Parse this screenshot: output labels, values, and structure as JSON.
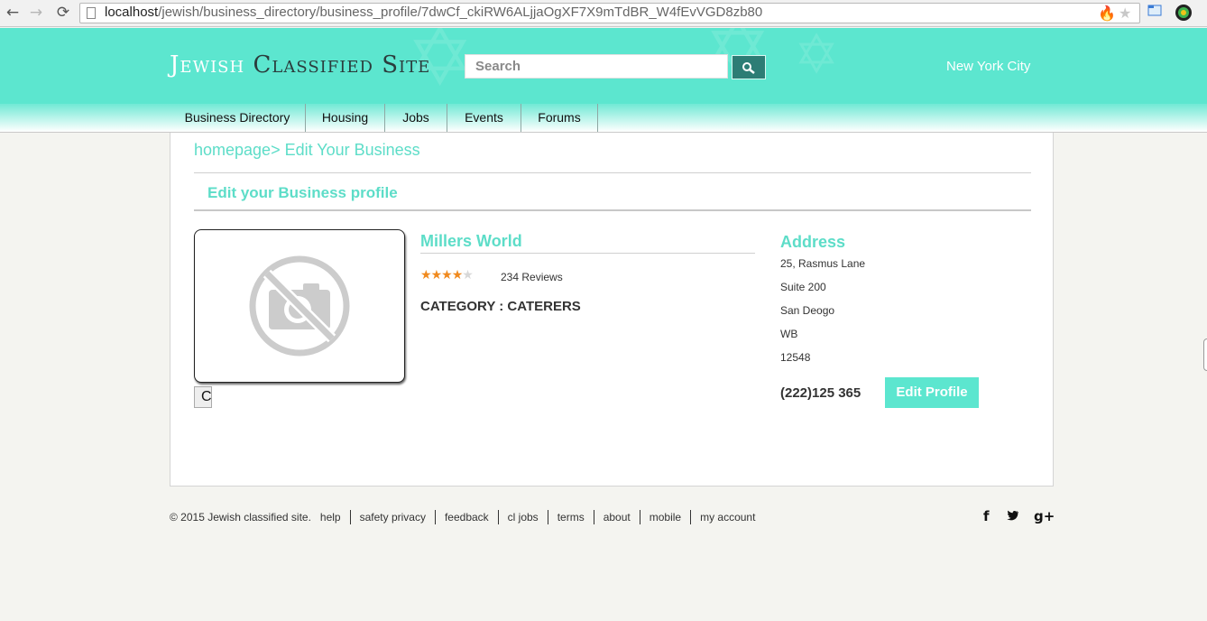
{
  "browser": {
    "back_icon": "←",
    "forward_icon": "→",
    "reload_icon": "⟳",
    "url_host": "localhost",
    "url_path": "/jewish/business_directory/business_profile/7dwCf_ckiRW6ALjjaOgXF7X9mTdBR_W4fEvVGD8zb80",
    "star_icon": "★",
    "flame_icon": "🔥"
  },
  "header": {
    "logo_word1": "Jewish",
    "logo_word2": "Classified Site",
    "search_placeholder": "Search",
    "city": "New York City",
    "brand_color": "#5ce6cf"
  },
  "nav": {
    "items": [
      {
        "label": "Business Directory"
      },
      {
        "label": "Housing"
      },
      {
        "label": "Jobs"
      },
      {
        "label": "Events"
      },
      {
        "label": "Forums"
      }
    ]
  },
  "main": {
    "breadcrumb": "homepage> Edit Your Business",
    "section_title": "Edit your Business profile",
    "change_button_label": "C",
    "business_name": "Millers World",
    "rating": 4,
    "rating_max": 5,
    "reviews": "234 Reviews",
    "category": "CATEGORY : CATERERS",
    "address_title": "Address",
    "address_lines": [
      "25, Rasmus Lane",
      "Suite 200",
      "San Deogo",
      "WB",
      "12548"
    ],
    "phone": "(222)125 365",
    "edit_button_label": "Edit Profile"
  },
  "footer": {
    "copyright": "© 2015 Jewish classified site.",
    "links": [
      "help",
      "safety privacy",
      "feedback",
      "cl jobs",
      "terms",
      "about",
      "mobile",
      "my account"
    ],
    "social": {
      "facebook": "f",
      "twitter": "🐦",
      "google_plus": "g+"
    }
  }
}
